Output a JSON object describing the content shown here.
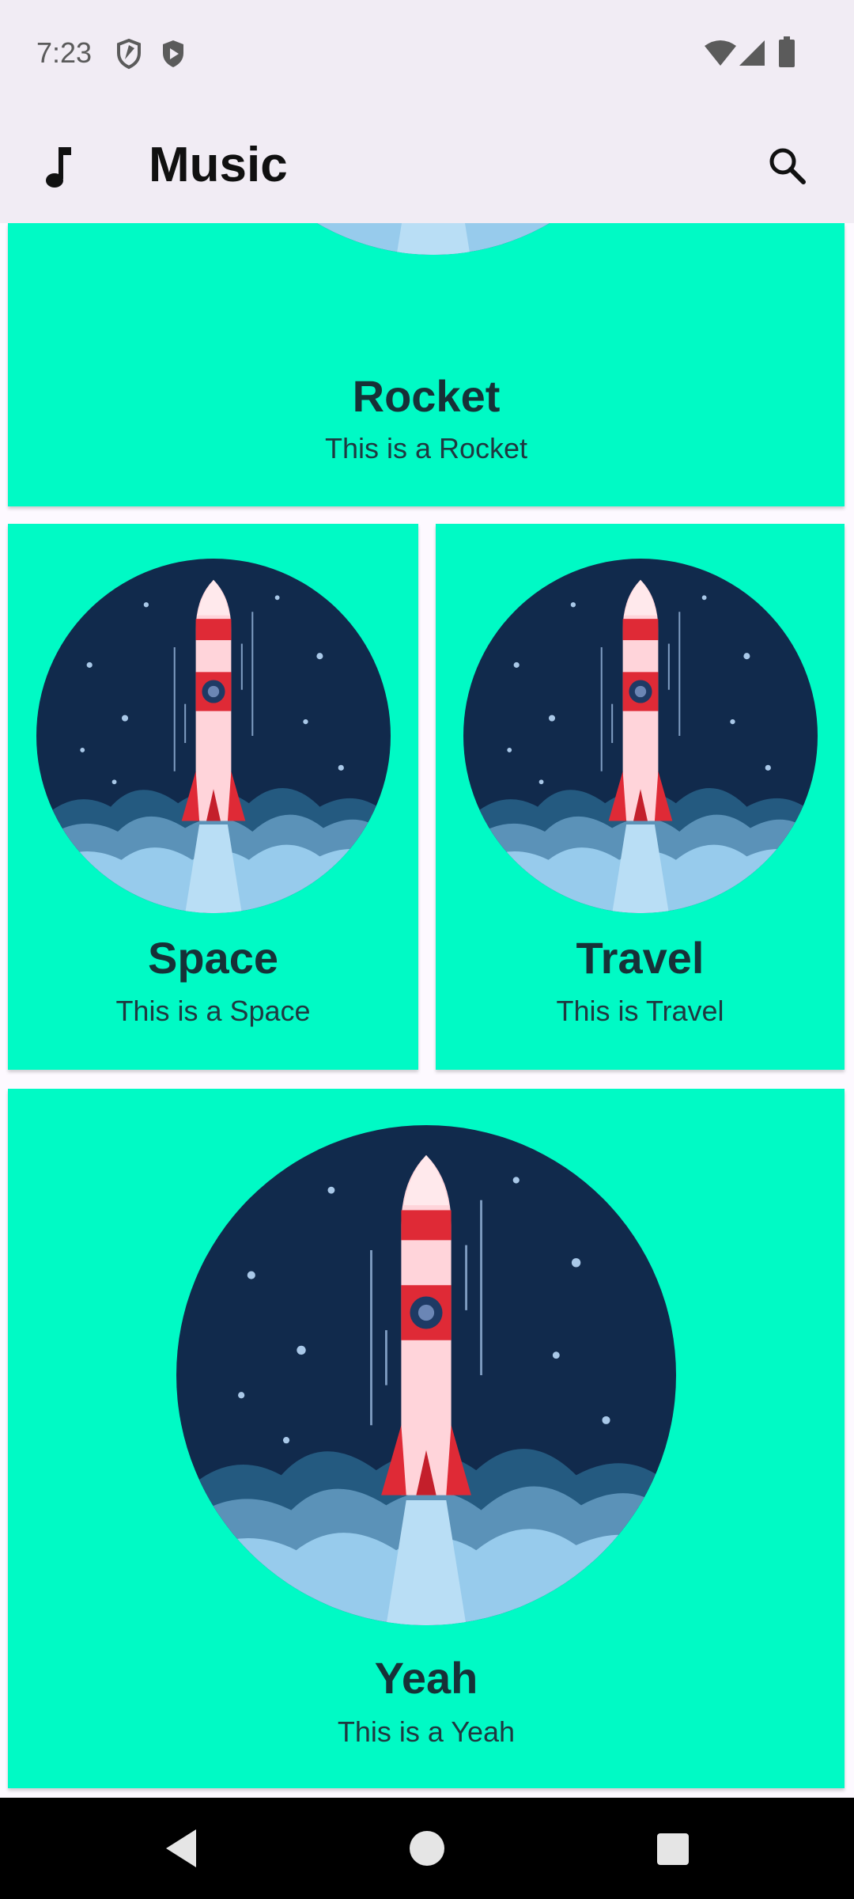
{
  "status_bar": {
    "time": "7:23",
    "left_icons": [
      "shield-icon",
      "play-protect-icon"
    ],
    "right_icons": [
      "wifi-icon",
      "signal-icon",
      "battery-icon"
    ]
  },
  "app_bar": {
    "leading_icon": "music-note-icon",
    "title": "Music",
    "action_icon": "search-icon"
  },
  "cards": [
    {
      "title": "Rocket",
      "subtitle": "This is a Rocket",
      "image": "rocket-illustration"
    },
    {
      "title": "Space",
      "subtitle": "This is a Space",
      "image": "rocket-illustration"
    },
    {
      "title": "Travel",
      "subtitle": "This is Travel",
      "image": "rocket-illustration"
    },
    {
      "title": "Yeah",
      "subtitle": "This is a Yeah",
      "image": "rocket-illustration"
    }
  ],
  "nav_bar": {
    "buttons": [
      "back-icon",
      "home-icon",
      "recents-icon"
    ]
  },
  "colors": {
    "card_background": "#00fac5",
    "app_bar_background": "#f1ecf4",
    "title_text": "#163137",
    "nav_bar": "#000000"
  }
}
